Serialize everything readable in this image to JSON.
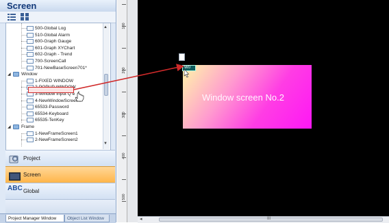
{
  "panel": {
    "title": "Screen",
    "tree": {
      "screens": [
        {
          "label": "500-Global Log"
        },
        {
          "label": "510-Global Alarm"
        },
        {
          "label": "600-Graph Gauge"
        },
        {
          "label": "601-Graph XYChart"
        },
        {
          "label": "602-Graph - Trend"
        },
        {
          "label": "700-ScreenCall"
        },
        {
          "label": "701-NewBaseScreen701*"
        }
      ],
      "window_folder": "Window",
      "windows": [
        {
          "label": "1-FIXED WINDOW"
        },
        {
          "label": "2-POPUP WINDOW"
        },
        {
          "label": "3-Window Input Q e"
        },
        {
          "label": "4-NewWindowScreen4"
        },
        {
          "label": "65533-Password"
        },
        {
          "label": "65534-Keyboard"
        },
        {
          "label": "65535-TenKey"
        }
      ],
      "frame_folder": "Frame",
      "frames": [
        {
          "label": "1-NewFrameScreen1"
        },
        {
          "label": "2-NewFrameScreen2"
        }
      ]
    },
    "nav": {
      "project": "Project",
      "screen": "Screen",
      "global": "Global",
      "global_icon_text": "ABC"
    },
    "tabs": {
      "project_manager": "Project Manager Window",
      "object_list": "Object List Window"
    }
  },
  "ruler": {
    "labels": [
      "100",
      "200",
      "300",
      "400",
      "500"
    ]
  },
  "canvas": {
    "window_label": "Window screen No.2",
    "tag_text": "W0"
  },
  "scrollbar": {
    "middle_grip": "III"
  },
  "colors": {
    "selection_border": "#d02a2a",
    "drag_arrow": "#d02a2a",
    "active_nav": "#ffb54a",
    "canvas_bg": "#000000"
  }
}
